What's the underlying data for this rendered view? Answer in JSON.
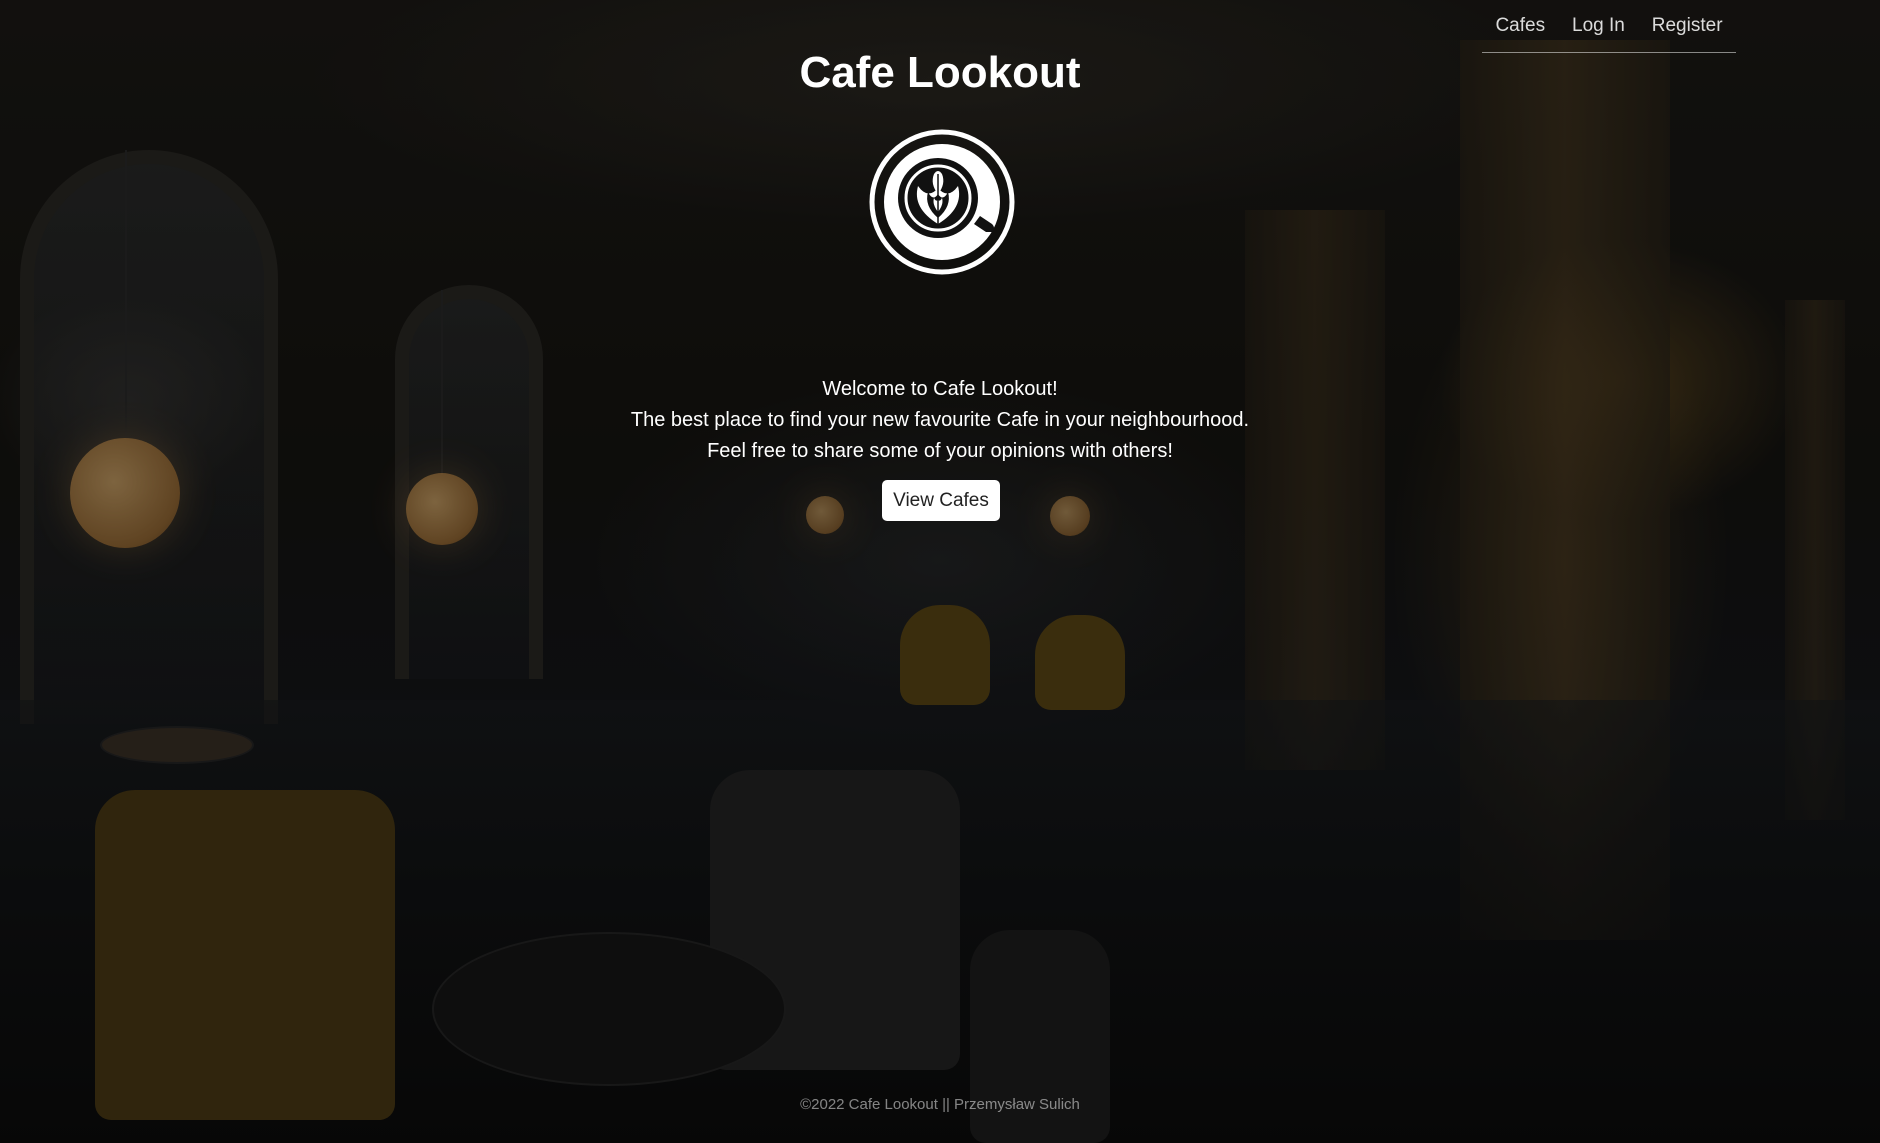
{
  "nav": {
    "links": [
      {
        "label": "Cafes"
      },
      {
        "label": "Log In"
      },
      {
        "label": "Register"
      }
    ]
  },
  "hero": {
    "title": "Cafe Lookout",
    "logo_icon": "latte-art-cup-icon",
    "lines": [
      "Welcome to Cafe Lookout!",
      "The best place to find your new favourite Cafe in your neighbourhood.",
      "Feel free to share some of your opinions with others!"
    ],
    "cta_label": "View Cafes"
  },
  "footer": {
    "text": "©2022 Cafe Lookout || Przemysław Sulich"
  },
  "colors": {
    "text": "#ffffff",
    "button_bg": "#ffffff",
    "button_text": "#222222",
    "footer_text": "#8a8a8a"
  }
}
